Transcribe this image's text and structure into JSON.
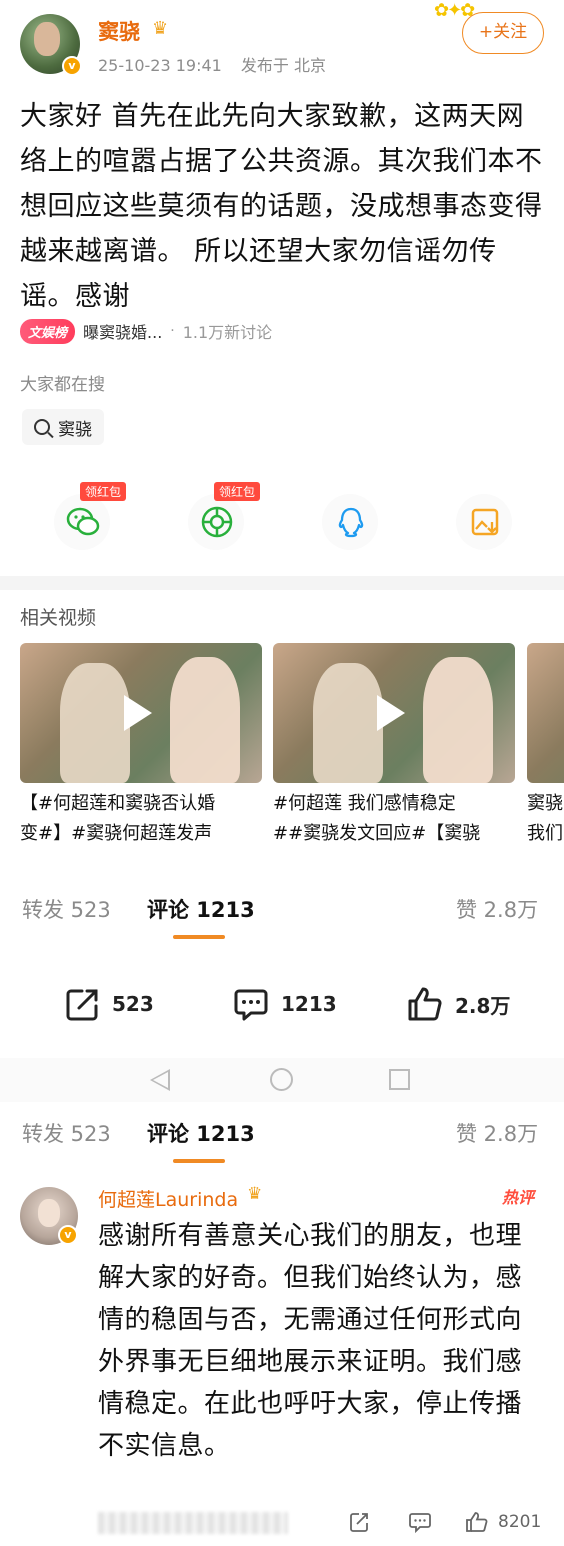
{
  "post": {
    "username": "窦骁",
    "timestamp": "25-10-23 19:41",
    "location": "发布于 北京",
    "follow_label": "+关注",
    "text": "大家好 首先在此先向大家致歉，这两天网络上的喧嚣占据了公共资源。其次我们本不想回应这些莫须有的话题，没成想事态变得越来越离谱。 所以还望大家勿信谣勿传谣。感谢"
  },
  "topic": {
    "badge": "文娱榜",
    "title": "曝窦骁婚...",
    "count": "1.1万新讨论"
  },
  "search": {
    "label": "大家都在搜",
    "chip": "窦骁"
  },
  "share": {
    "items": [
      {
        "name": "wechat",
        "badge": "领红包"
      },
      {
        "name": "moments",
        "badge": "领红包"
      },
      {
        "name": "qq",
        "badge": ""
      },
      {
        "name": "save-image",
        "badge": ""
      }
    ]
  },
  "related": {
    "title": "相关视频",
    "videos": [
      {
        "line1": "【#何超莲和窦骁否认婚",
        "line2": "变#】#窦骁何超莲发声"
      },
      {
        "line1": "#何超莲 我们感情稳定",
        "line2": "##窦骁发文回应#【窦骁"
      },
      {
        "line1": "窦骁",
        "line2": "我们"
      }
    ]
  },
  "tabs": {
    "repost": "转发 523",
    "comment": "评论 1213",
    "like": "赞 2.8万"
  },
  "actions": {
    "repost": "523",
    "comment": "1213",
    "like": "2.8万"
  },
  "comment": {
    "name": "何超莲Laurinda",
    "hot": "热评",
    "text": "感谢所有善意关心我们的朋友，也理解大家的好奇。但我们始终认为，感情的稳固与否，无需通过任何形式向外界事无巨细地展示来证明。我们感情稳定。在此也呼吁大家，停止传播不实信息。",
    "likes": "8201"
  },
  "colors": {
    "accent": "#f08a24",
    "username": "#e86b0e",
    "red": "#ff4a3d"
  }
}
